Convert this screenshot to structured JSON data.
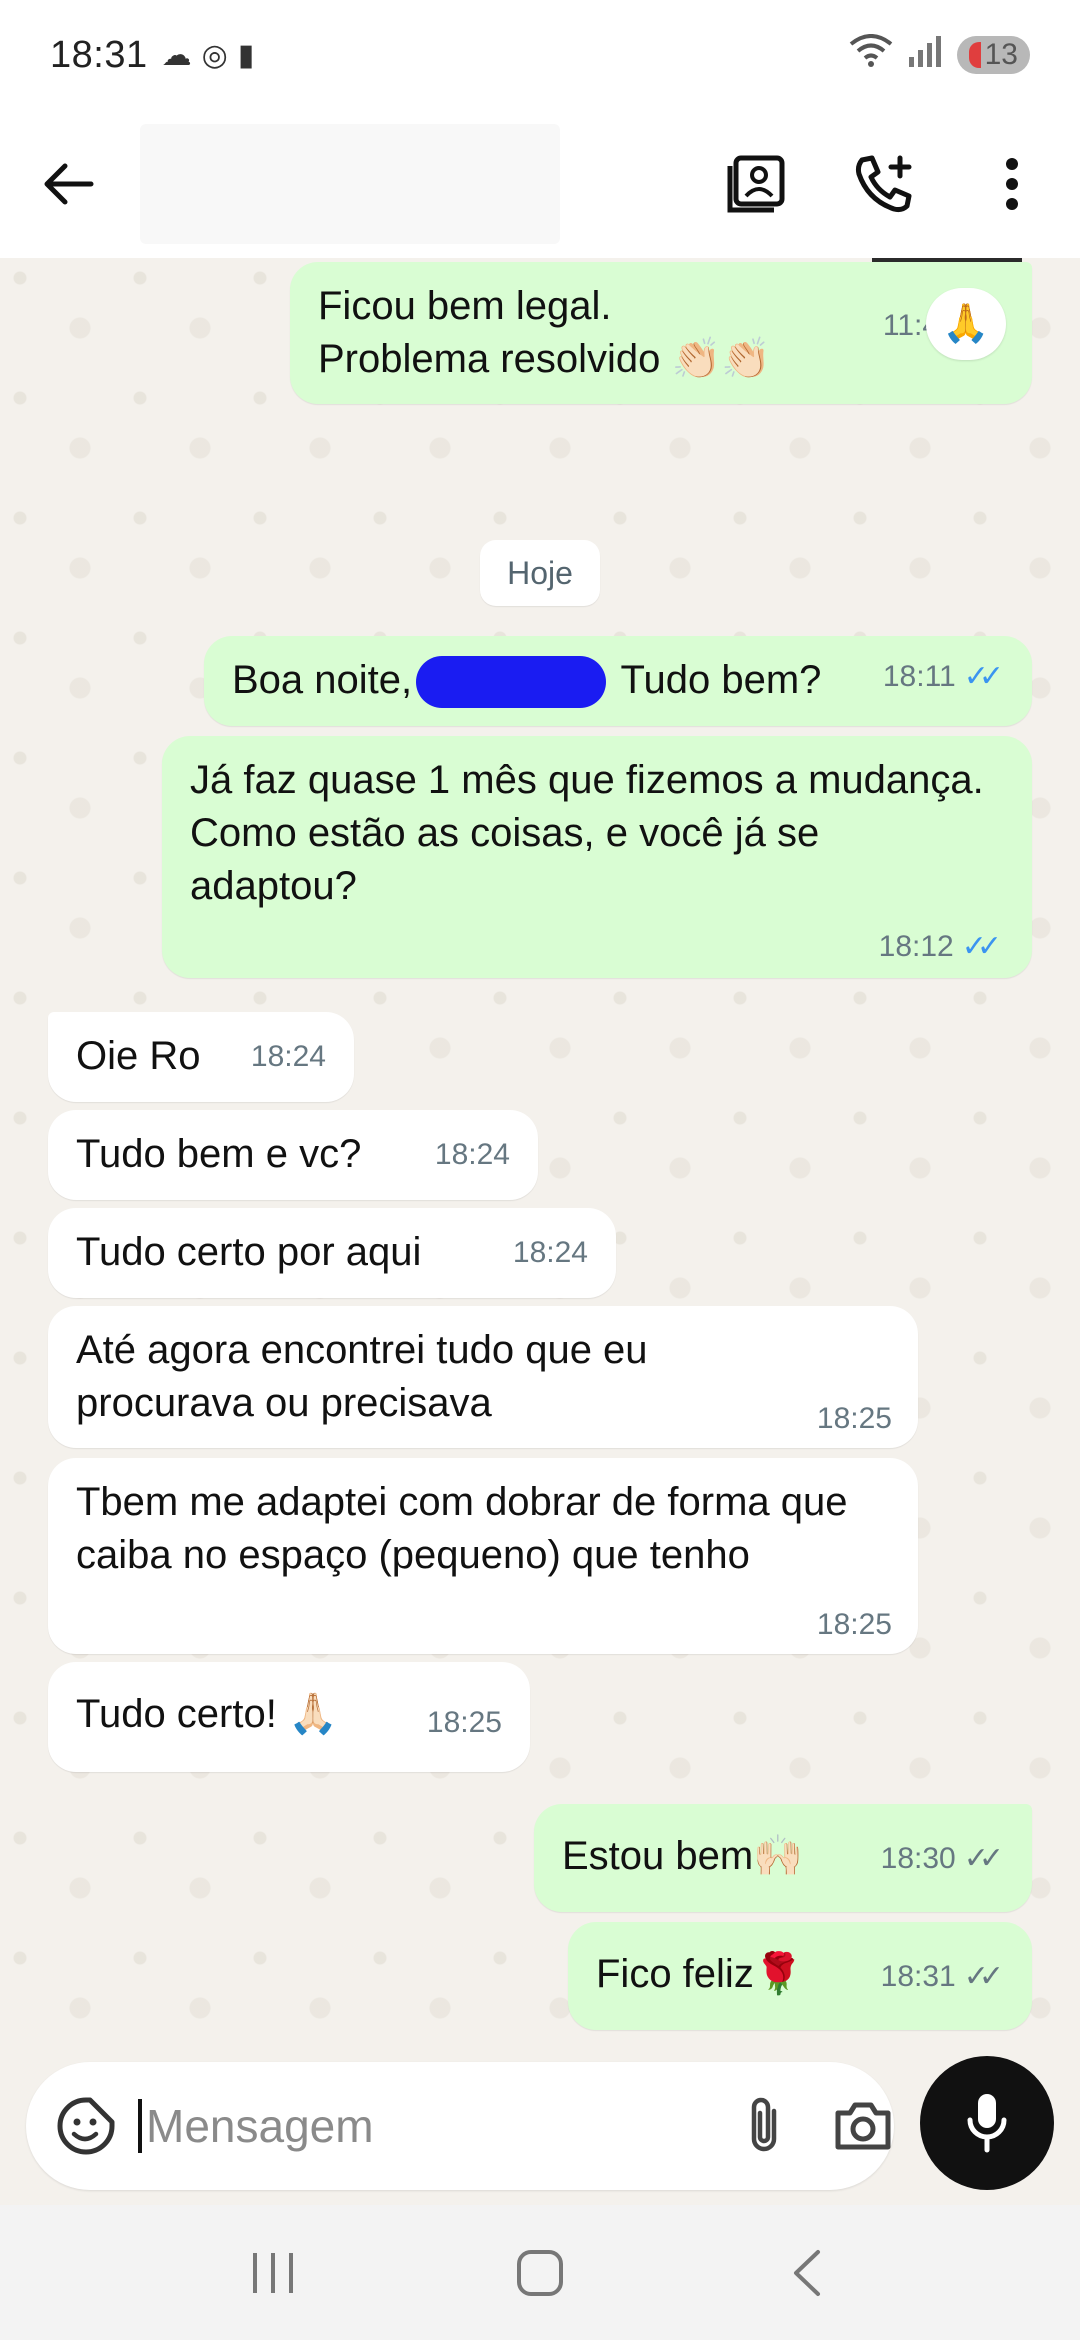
{
  "status_bar": {
    "time": "18:31",
    "battery": "13",
    "left_icons": [
      "cloud-icon",
      "whatsapp-icon",
      "clipboard-icon"
    ],
    "right_icons": [
      "wifi-icon",
      "signal-icon",
      "battery-icon"
    ]
  },
  "header": {
    "icons": [
      "back-arrow-icon",
      "contact-card-icon",
      "add-call-icon",
      "more-vert-icon"
    ]
  },
  "chat": {
    "date_chip": "Hoje",
    "reaction": "🙏",
    "messages": [
      {
        "dir": "out",
        "text": "Ficou bem legal.\nProblema resolvido 👏🏻👏🏻",
        "time": "11:42",
        "status": "read"
      },
      {
        "dir": "out",
        "text_before": "Boa noite,",
        "text_after": " Tudo bem?",
        "time": "18:11",
        "status": "read"
      },
      {
        "dir": "out",
        "text": "Já faz quase 1 mês que fizemos a mudança.\nComo estão as coisas, e você já se adaptou?",
        "time": "18:12",
        "status": "read"
      },
      {
        "dir": "in",
        "text": "Oie Ro",
        "time": "18:24"
      },
      {
        "dir": "in",
        "text": "Tudo bem e vc?",
        "time": "18:24"
      },
      {
        "dir": "in",
        "text": "Tudo certo por aqui",
        "time": "18:24"
      },
      {
        "dir": "in",
        "text": "Até agora encontrei tudo que eu procurava ou precisava",
        "time": "18:25"
      },
      {
        "dir": "in",
        "text": "Tbem me adaptei com dobrar de forma que caiba no espaço (pequeno) que tenho",
        "time": "18:25"
      },
      {
        "dir": "in",
        "text": "Tudo certo! 🙏🏻",
        "time": "18:25"
      },
      {
        "dir": "out",
        "text": "Estou bem🙌🏻",
        "time": "18:30",
        "status": "delivered"
      },
      {
        "dir": "out",
        "text": "Fico feliz🌹",
        "time": "18:31",
        "status": "delivered"
      }
    ]
  },
  "composer": {
    "placeholder": "Mensagem"
  },
  "colors": {
    "outgoing_bubble": "#d9fdd3",
    "incoming_bubble": "#ffffff",
    "read_ticks": "#3b94f0",
    "mic_button": "#111111"
  }
}
